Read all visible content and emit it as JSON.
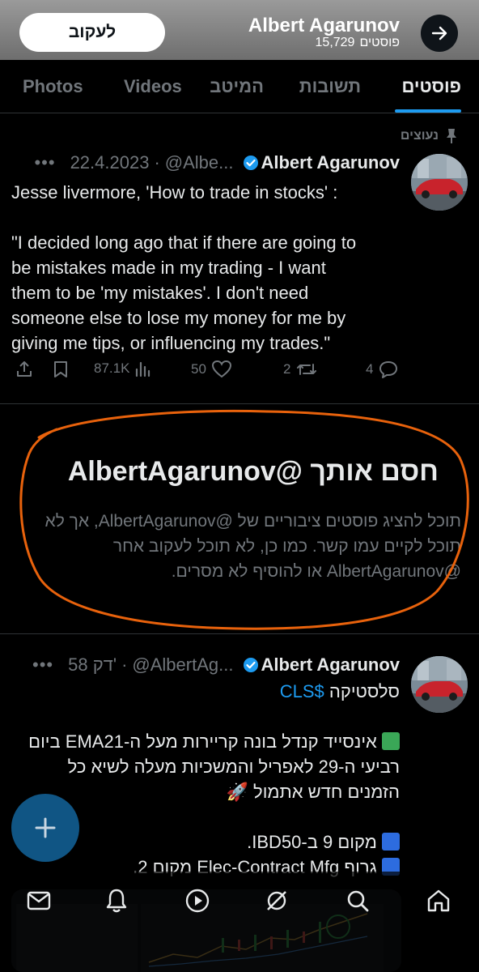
{
  "header": {
    "follow_label": "לעקוב",
    "profile_name": "Albert Agarunov",
    "post_count": "15,729",
    "post_count_label": "פוסטים"
  },
  "tabs": [
    {
      "label": "פוסטים",
      "active": true
    },
    {
      "label": "תשובות",
      "active": false
    },
    {
      "label": "המיטב",
      "active": false
    },
    {
      "label": "Videos",
      "active": false
    },
    {
      "label": "Photos",
      "active": false
    }
  ],
  "pinned_post": {
    "pinned_label": "נעוצים",
    "author": "Albert Agarunov",
    "handle": "@Albe...",
    "date": "22.4.2023",
    "lines": [
      "Jesse livermore, 'How to trade in stocks' :",
      "",
      "\"I decided long ago that if there are going to",
      "be mistakes made in my trading - I want",
      "them to be 'my mistakes'. I don't need",
      "someone else to lose my money for me by",
      "giving me tips, or influencing my trades.\""
    ],
    "replies": "4",
    "reposts": "2",
    "likes": "50",
    "views": "87.1K"
  },
  "blocked_notice": {
    "title": "חסם אותך @AlbertAgarunov",
    "text": "תוכל להציג פוסטים ציבוריים של @AlbertAgarunov, אך לא תוכל לקיים עמו קשר. כמו כן, לא תוכל לעקוב אחר @AlbertAgarunov או להוסיף לא מסרים.",
    "annotation_color": "#e8620c"
  },
  "second_post": {
    "author": "Albert Agarunov",
    "handle": "@AlbertAg...",
    "time": "58 דק'",
    "line1_prefix": "סלסטיקה",
    "cashtag": "$CLS",
    "line2": "אינסייד קנדל בונה קריירות מעל ה-EMA21 ביום",
    "line3": "רביעי ה-29 לאפריל והמשכיות מעלה לשיא כל",
    "line4": "הזמנים חדש אתמול",
    "line5": "מקום 9 ב-IBD50.",
    "line6": "גרוף Elec-Contract Mfg מקום 2."
  },
  "colors": {
    "accent": "#1d9bf0",
    "background": "#000000",
    "muted_text": "#71767b"
  },
  "bottom_nav": [
    {
      "icon": "mail-icon"
    },
    {
      "icon": "bell-icon"
    },
    {
      "icon": "play-icon"
    },
    {
      "icon": "grok-icon"
    },
    {
      "icon": "search-icon"
    },
    {
      "icon": "home-icon"
    }
  ]
}
